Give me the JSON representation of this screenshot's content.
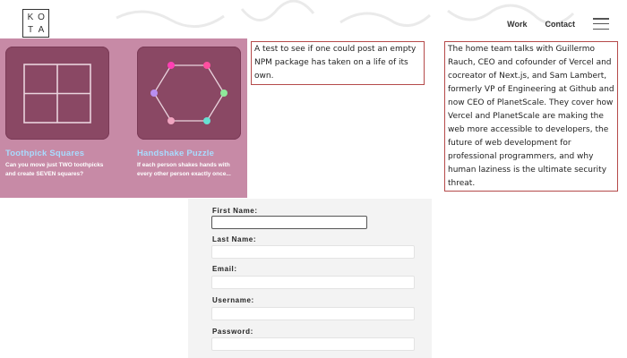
{
  "header": {
    "logo_letters": [
      "K",
      "O",
      "T",
      "A"
    ],
    "nav": {
      "work": "Work",
      "contact": "Contact"
    },
    "menu_icon": "hamburger-icon"
  },
  "cards": [
    {
      "title": "Toothpick Squares",
      "description": "Can you move just TWO toothpicks and create SEVEN squares?",
      "icon": "toothpick-grid-icon"
    },
    {
      "title": "Handshake Puzzle",
      "description": "If each person shakes hands with every other person exactly once...",
      "icon": "handshake-hexagon-icon"
    }
  ],
  "articles": [
    {
      "text": "A test to see if one could post an empty NPM package has taken on a life of its own."
    },
    {
      "text": "The home team talks with Guillermo Rauch, CEO and cofounder of Vercel and cocreator of Next.js, and Sam Lambert, formerly VP of Engineering at Github and now CEO of PlanetScale. They cover how Vercel and PlanetScale are making the web more accessible to developers, the future of web development for professional programmers, and why human laziness is the ultimate security threat."
    }
  ],
  "form": {
    "fields": [
      {
        "label": "First Name:",
        "value": ""
      },
      {
        "label": "Last Name:",
        "value": ""
      },
      {
        "label": "Email:",
        "value": ""
      },
      {
        "label": "Username:",
        "value": ""
      },
      {
        "label": "Password:",
        "value": ""
      }
    ]
  },
  "colors": {
    "panel_pink": "#c78aa6",
    "tile_plum": "#8a4864",
    "card_title_blue": "#a8dcff",
    "box_border_red": "#b54a4a",
    "form_bg": "#f3f3f3"
  }
}
